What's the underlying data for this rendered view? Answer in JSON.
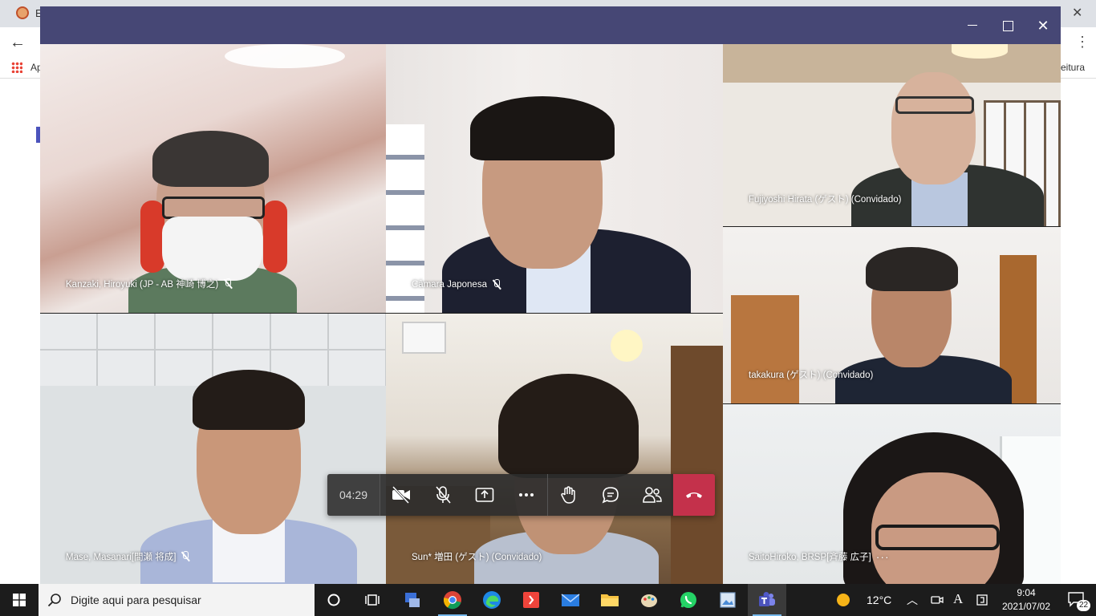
{
  "browser": {
    "tab_letter": "E",
    "apps_label": "Ap",
    "reading_label": "eitura"
  },
  "meeting": {
    "timer": "04:29",
    "participants": [
      {
        "name": "Kanzaki, Hiroyuki (JP - AB 神崎 博之)",
        "muted": true
      },
      {
        "name": "Câmara Japonesa",
        "muted": true
      },
      {
        "name": "Fujiyoshi Hirata (ゲスト) (Convidado)",
        "muted": false
      },
      {
        "name": "takakura (ゲスト) (Convidado)",
        "muted": false
      },
      {
        "name": "Mase, Masanari[間瀬 将成]",
        "muted": true
      },
      {
        "name": "Sun* 増田 (ゲスト) (Convidado)",
        "muted": false
      },
      {
        "name": "SaitoHiroko, BRSP[斉藤 広子]",
        "muted": false,
        "more": "···"
      }
    ],
    "controls": [
      "camera-off",
      "mic-off",
      "share",
      "more",
      "raise-hand",
      "chat",
      "participants",
      "hang-up"
    ]
  },
  "taskbar": {
    "search_placeholder": "Digite aqui para pesquisar",
    "weather_temp": "12°C",
    "ime_label": "A",
    "time": "9:04",
    "date": "2021/07/02",
    "notification_count": "22"
  },
  "colors": {
    "teams_titlebar": "#464775",
    "hangup": "#c4314b",
    "taskbar": "#1c1c1c"
  }
}
